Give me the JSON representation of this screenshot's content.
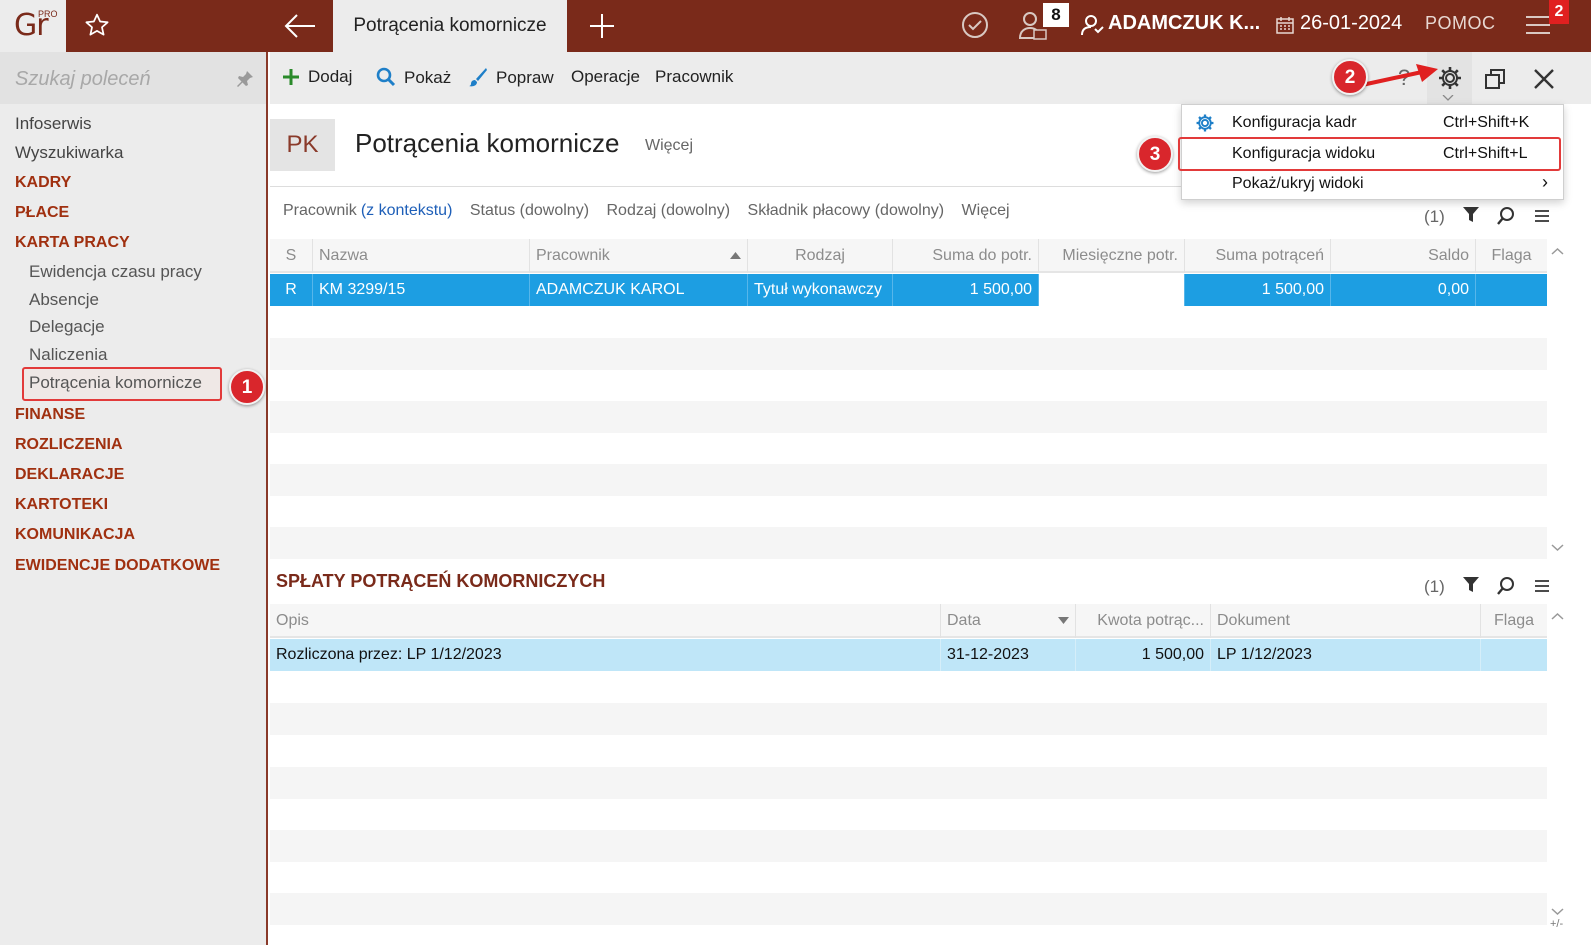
{
  "app": {
    "logo_text": "Gr",
    "logo_badge": "PRO"
  },
  "topbar": {
    "active_tab": "Potrącenia komornicze",
    "notifications_count": "8",
    "user_name": "ADAMCZUK K...",
    "date": "26-01-2024",
    "help_label": "POMOC",
    "menu_badge": "2"
  },
  "sidebar": {
    "search_placeholder": "Szukaj poleceń",
    "items": [
      {
        "label": "Infoserwis",
        "type": "item"
      },
      {
        "label": "Wyszukiwarka",
        "type": "item"
      },
      {
        "label": "KADRY",
        "type": "category"
      },
      {
        "label": "PŁACE",
        "type": "category"
      },
      {
        "label": "KARTA PRACY",
        "type": "category"
      },
      {
        "label": "Ewidencja czasu pracy",
        "type": "sub"
      },
      {
        "label": "Absencje",
        "type": "sub"
      },
      {
        "label": "Delegacje",
        "type": "sub"
      },
      {
        "label": "Naliczenia",
        "type": "sub"
      },
      {
        "label": "Potrącenia komornicze",
        "type": "sub",
        "active": true
      },
      {
        "label": "FINANSE",
        "type": "category"
      },
      {
        "label": "ROZLICZENIA",
        "type": "category"
      },
      {
        "label": "DEKLARACJE",
        "type": "category"
      },
      {
        "label": "KARTOTEKI",
        "type": "category"
      },
      {
        "label": "KOMUNIKACJA",
        "type": "category"
      },
      {
        "label": "EWIDENCJE DODATKOWE",
        "type": "category"
      }
    ]
  },
  "toolbar": {
    "add": "Dodaj",
    "show": "Pokaż",
    "edit": "Popraw",
    "operations": "Operacje",
    "employee": "Pracownik",
    "help": "?"
  },
  "header": {
    "badge": "PK",
    "title": "Potrącenia komornicze",
    "more": "Więcej"
  },
  "filters": {
    "employee_label": "Pracownik",
    "employee_value": "(z kontekstu)",
    "status": "Status (dowolny)",
    "type": "Rodzaj (dowolny)",
    "component": "Składnik płacowy (dowolny)",
    "more": "Więcej"
  },
  "grid1": {
    "count": "(1)",
    "columns": [
      "S",
      "Nazwa",
      "Pracownik",
      "Rodzaj",
      "Suma do potr.",
      "Miesięczne potr.",
      "Suma potrąceń",
      "Saldo",
      "Flaga"
    ],
    "rows": [
      [
        "R",
        "KM 3299/15",
        "ADAMCZUK KAROL",
        "Tytuł wykonawczy",
        "1 500,00",
        "",
        "1 500,00",
        "0,00",
        ""
      ]
    ]
  },
  "section2": {
    "title": "SPŁATY POTRĄCEŃ KOMORNICZYCH",
    "count": "(1)",
    "columns": [
      "Opis",
      "Data",
      "Kwota potrąc...",
      "Dokument",
      "Flaga"
    ],
    "rows": [
      [
        "Rozliczona przez: LP 1/12/2023",
        "31-12-2023",
        "1 500,00",
        "LP 1/12/2023",
        ""
      ]
    ]
  },
  "dropdown": {
    "items": [
      {
        "label": "Konfiguracja kadr",
        "shortcut": "Ctrl+Shift+K"
      },
      {
        "label": "Konfiguracja widoku",
        "shortcut": "Ctrl+Shift+L"
      },
      {
        "label": "Pokaż/ukryj widoki",
        "shortcut": "›"
      }
    ]
  },
  "callouts": [
    "1",
    "2",
    "3"
  ],
  "footer_marker": "+/-",
  "colors": {
    "brand": "#7a2a1a",
    "category": "#a03010",
    "selection": "#1d9ee2",
    "selection_light": "#bfe6f8",
    "callout": "#d9262c"
  }
}
